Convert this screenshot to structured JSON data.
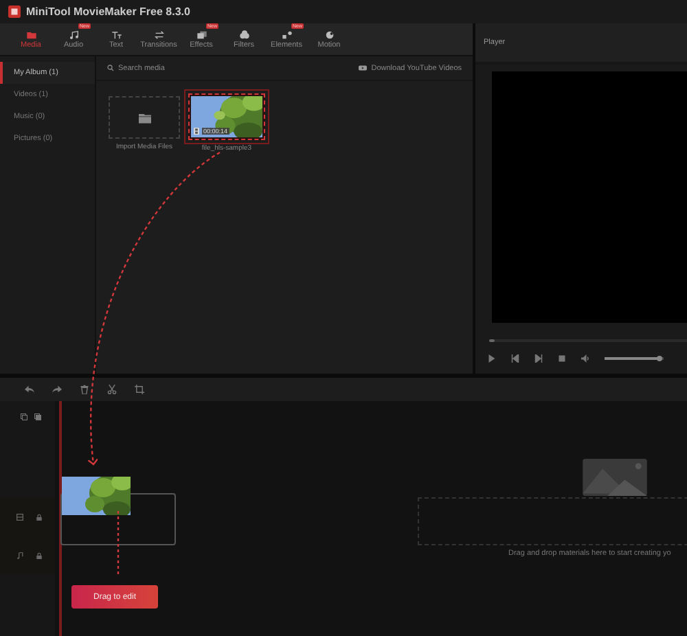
{
  "window": {
    "title": "MiniTool MovieMaker Free 8.3.0"
  },
  "toolbar": [
    {
      "kind": "media",
      "label": "Media",
      "selected": true
    },
    {
      "kind": "audio",
      "label": "Audio",
      "selected": false,
      "badge": "New"
    },
    {
      "kind": "text",
      "label": "Text",
      "selected": false
    },
    {
      "kind": "transitions",
      "label": "Transitions",
      "selected": false
    },
    {
      "kind": "effects",
      "label": "Effects",
      "selected": false,
      "badge": "New"
    },
    {
      "kind": "filters",
      "label": "Filters",
      "selected": false
    },
    {
      "kind": "elements",
      "label": "Elements",
      "selected": false,
      "badge": "New"
    },
    {
      "kind": "motion",
      "label": "Motion",
      "selected": false
    }
  ],
  "sidebar": {
    "items": [
      {
        "label": "My Album (1)",
        "selected": true
      },
      {
        "label": "Videos (1)",
        "selected": false
      },
      {
        "label": "Music (0)",
        "selected": false
      },
      {
        "label": "Pictures (0)",
        "selected": false
      }
    ]
  },
  "media": {
    "search": {
      "placeholder": "Search media"
    },
    "download_link": "Download YouTube Videos",
    "items": [
      {
        "kind": "import",
        "label": "Import Media Files"
      },
      {
        "kind": "clip",
        "label": "file_hls-sample3",
        "duration": "00:00:14",
        "selected": true
      }
    ]
  },
  "player": {
    "title": "Player",
    "seek": {
      "level": 0
    },
    "volume": {
      "level": 0.93
    }
  },
  "timeline": {
    "drop_hint": "Drag and drop materials here to start creating yo",
    "tooltip": "Drag to edit"
  }
}
